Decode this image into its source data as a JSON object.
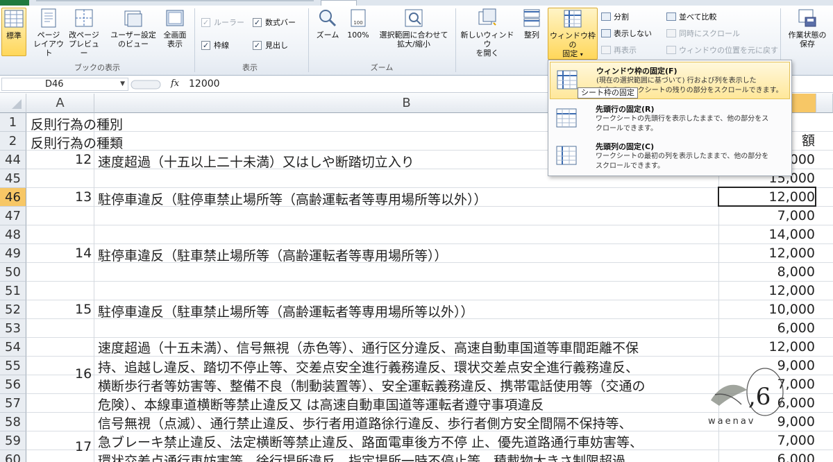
{
  "ribbon": {
    "book_views": {
      "group_label": "ブックの表示",
      "normal": "標準",
      "page_layout": [
        "ページ",
        "レイアウト"
      ],
      "page_break": [
        "改ページ",
        "プレビュー"
      ],
      "custom_views": [
        "ユーザー設定",
        "のビュー"
      ],
      "full_screen": [
        "全画面",
        "表示"
      ]
    },
    "show": {
      "group_label": "表示",
      "ruler": "ルーラー",
      "formula_bar": "数式バー",
      "gridlines": "枠線",
      "headings": "見出し"
    },
    "zoom": {
      "group_label": "ズーム",
      "zoom": "ズーム",
      "zoom100": "100%",
      "zoom_selection": [
        "選択範囲に合わせて",
        "拡大/縮小"
      ]
    },
    "window": {
      "new_window": [
        "新しいウィンドウ",
        "を開く"
      ],
      "arrange": "整列",
      "freeze_panes": [
        "ウィンドウ枠の",
        "固定"
      ],
      "split": "分割",
      "hide": "表示しない",
      "unhide": "再表示",
      "side_by_side": "並べて比較",
      "sync_scroll": "同時にスクロール",
      "reset_position": "ウィンドウの位置を元に戻す",
      "save_workspace": [
        "作業状態の",
        "保存"
      ]
    }
  },
  "formula_bar": {
    "name_box": "D46",
    "fx": "fx",
    "value": "12000"
  },
  "columns": [
    "A",
    "B"
  ],
  "col_d_partial": "額",
  "rows": [
    {
      "num": "1",
      "a": "反則行為の種別",
      "d": ""
    },
    {
      "num": "2",
      "a": "反則行為の種類",
      "d": "額"
    },
    {
      "num": "44",
      "a": "12",
      "b": "速度超過（十五以上二十未満）又はしや断踏切立入り",
      "d": "12,000"
    },
    {
      "num": "45",
      "d": "15,000"
    },
    {
      "num": "46",
      "a": "13",
      "b": "駐停車違反（駐停車禁止場所等（高齢運転者等専用場所等以外））",
      "d": "12,000"
    },
    {
      "num": "47",
      "d": "7,000"
    },
    {
      "num": "48",
      "d": "14,000"
    },
    {
      "num": "49",
      "a": "14",
      "b": "駐停車違反（駐車禁止場所等（高齢運転者等専用場所等））",
      "d": "12,000"
    },
    {
      "num": "50",
      "d": "8,000"
    },
    {
      "num": "51",
      "d": "12,000"
    },
    {
      "num": "52",
      "a": "15",
      "b": "駐停車違反（駐車禁止場所等（高齢運転者等専用場所等以外））",
      "d": "10,000"
    },
    {
      "num": "53",
      "d": "6,000"
    },
    {
      "num": "54",
      "d": "12,000"
    },
    {
      "num": "55",
      "d": "9,000"
    },
    {
      "num": "56",
      "d": "7,000"
    },
    {
      "num": "57",
      "d": "6,000"
    },
    {
      "num": "58",
      "d": "9,000"
    },
    {
      "num": "59",
      "d": "7,000"
    },
    {
      "num": "60",
      "d": "6,000"
    }
  ],
  "block16": {
    "a": "16",
    "lines": [
      "速度超過（十五未満）、信号無視（赤色等）、通行区分違反、高速自動車国道等車間距離不保",
      "持、追越し違反、踏切不停止等、交差点安全進行義務違反、環状交差点安全進行義務違反、",
      "横断歩行者等妨害等、整備不良（制動装置等）、安全運転義務違反、携帯電話使用等（交通の",
      "危険）、本線車道横断等禁止違反又 は高速自動車国道等運転者遵守事項違反"
    ]
  },
  "block17": {
    "a": "17",
    "lines": [
      "信号無視（点滅）、通行禁止違反、歩行者用道路徐行違反、歩行者側方安全間隔不保持等、",
      "急ブレーキ禁止違反、法定横断等禁止違反、路面電車後方不停 止、優先道路通行車妨害等、",
      "環状交差点通行車妨害等、徐行場所違反、指定場所一時不停止等、積載物大きさ制限超過、"
    ]
  },
  "menu": {
    "items": [
      {
        "title": "ウィンドウ枠の固定(F)",
        "desc": [
          "(現在の選択範囲に基づいて) 行および列を表示した",
          "ままで、ワークシートの残りの部分をスクロールできます。"
        ]
      },
      {
        "title": "先頭行の固定(R)",
        "desc": [
          "ワークシートの先頭行を表示したままで、他の部分をス",
          "クロールできます。"
        ]
      },
      {
        "title": "先頭列の固定(C)",
        "desc": [
          "ワークシートの最初の列を表示したままで、他の部分を",
          "スクロールできます。"
        ]
      }
    ],
    "tooltip": "シート枠の固定"
  },
  "watermark": "waenav"
}
